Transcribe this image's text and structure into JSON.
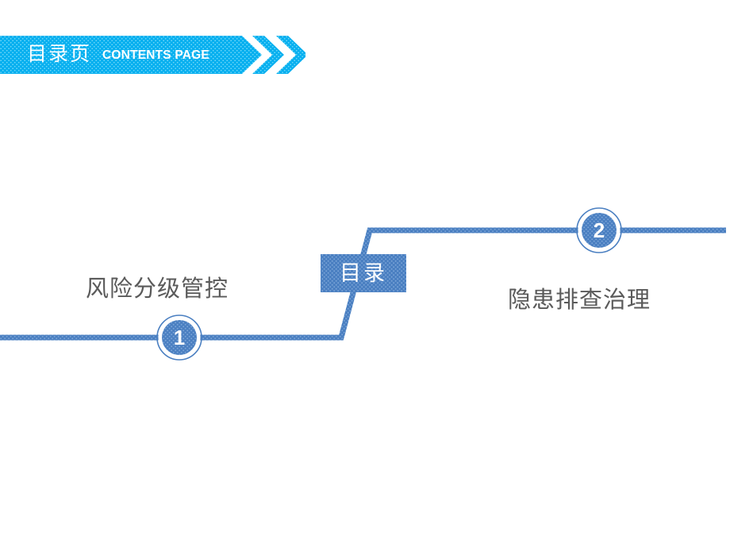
{
  "slide": {
    "title_cn": "目录页",
    "title_en": "CONTENTS PAGE",
    "background_color": "#FFFFFF"
  },
  "header": {
    "band_color": "#00AEEF",
    "chevron_color": "#00AEEF",
    "text_color": "#FFFFFF"
  },
  "center": {
    "label": "目录",
    "box_color": "#4A7FC1",
    "text_color": "#FFFFFF"
  },
  "connector": {
    "line_color": "#4A7FC1",
    "line_thickness": 7
  },
  "nodes": [
    {
      "number": "1",
      "caption": "风险分级管控",
      "marker_fill": "#4A7FC1",
      "ring_color": "#4A7FC1",
      "number_color": "#FFFFFF",
      "caption_color": "#5A5A5A"
    },
    {
      "number": "2",
      "caption": "隐患排查治理",
      "marker_fill": "#4A7FC1",
      "ring_color": "#4A7FC1",
      "number_color": "#FFFFFF",
      "caption_color": "#5A5A5A"
    }
  ]
}
